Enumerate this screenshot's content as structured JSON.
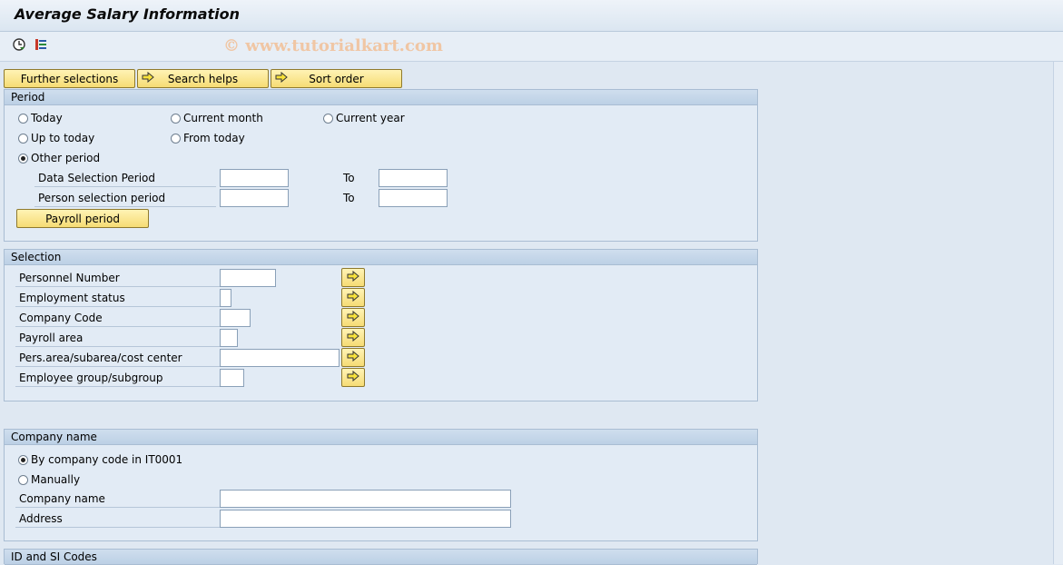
{
  "window": {
    "title": "Average Salary Information"
  },
  "toolbar": {
    "execute_icon": "clock-execute-icon",
    "variant_icon": "list-variant-icon",
    "watermark": "© www.tutorialkart.com"
  },
  "buttons": {
    "further_selections": "Further selections",
    "search_helps": "Search helps",
    "sort_order": "Sort order"
  },
  "period": {
    "title": "Period",
    "radios": [
      {
        "label": "Today",
        "selected": false
      },
      {
        "label": "Current month",
        "selected": false
      },
      {
        "label": "Current year",
        "selected": false
      },
      {
        "label": "Up to today",
        "selected": false
      },
      {
        "label": "From today",
        "selected": false
      },
      {
        "label": "Other period",
        "selected": true
      }
    ],
    "fields": [
      {
        "label": "Data Selection Period",
        "from": "",
        "to_label": "To",
        "to": ""
      },
      {
        "label": "Person selection period",
        "from": "",
        "to_label": "To",
        "to": ""
      }
    ],
    "payroll_button": "Payroll period"
  },
  "selection": {
    "title": "Selection",
    "fields": [
      {
        "label": "Personnel Number",
        "value": ""
      },
      {
        "label": "Employment status",
        "value": ""
      },
      {
        "label": "Company Code",
        "value": ""
      },
      {
        "label": "Payroll area",
        "value": ""
      },
      {
        "label": "Pers.area/subarea/cost center",
        "value": ""
      },
      {
        "label": "Employee group/subgroup",
        "value": ""
      }
    ]
  },
  "company": {
    "title": "Company name",
    "radios": [
      {
        "label": "By company code in IT0001",
        "selected": true
      },
      {
        "label": "Manually",
        "selected": false
      }
    ],
    "fields": [
      {
        "label": "Company name",
        "value": ""
      },
      {
        "label": "Address",
        "value": ""
      }
    ]
  },
  "idsi": {
    "title": "ID and SI Codes"
  },
  "colors": {
    "button_yellow": "#f6dc74",
    "group_header": "#bcd0e5",
    "background": "#dfe8f2"
  }
}
